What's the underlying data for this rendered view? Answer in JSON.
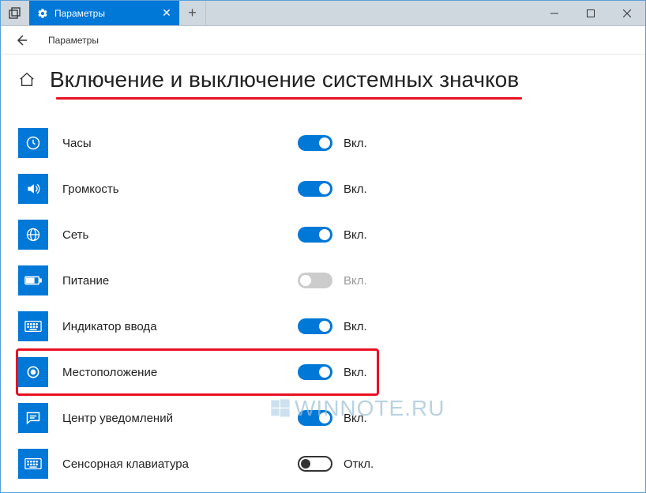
{
  "titlebar": {
    "tab_title": "Параметры"
  },
  "breadcrumb": {
    "label": "Параметры"
  },
  "page": {
    "title": "Включение и выключение системных значков"
  },
  "toggle_labels": {
    "on": "Вкл.",
    "off": "Откл."
  },
  "settings": [
    {
      "id": "clock",
      "icon": "clock",
      "label": "Часы",
      "state": "on",
      "highlighted": false
    },
    {
      "id": "volume",
      "icon": "volume",
      "label": "Громкость",
      "state": "on",
      "highlighted": false
    },
    {
      "id": "network",
      "icon": "globe",
      "label": "Сеть",
      "state": "on",
      "highlighted": false
    },
    {
      "id": "power",
      "icon": "battery",
      "label": "Питание",
      "state": "disabled",
      "highlighted": false
    },
    {
      "id": "input",
      "icon": "keyboard",
      "label": "Индикатор ввода",
      "state": "on",
      "highlighted": false
    },
    {
      "id": "location",
      "icon": "location",
      "label": "Местоположение",
      "state": "on",
      "highlighted": true
    },
    {
      "id": "action-center",
      "icon": "message",
      "label": "Центр уведомлений",
      "state": "on",
      "highlighted": false
    },
    {
      "id": "touch-keyboard",
      "icon": "keyboard",
      "label": "Сенсорная клавиатура",
      "state": "off",
      "highlighted": false
    }
  ],
  "watermark": "WINNOTE.RU"
}
